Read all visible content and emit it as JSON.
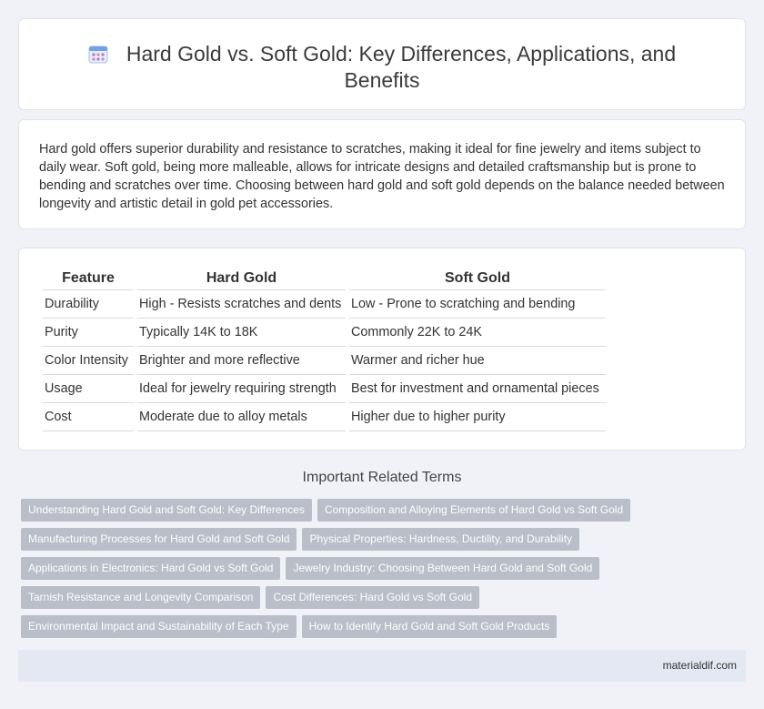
{
  "header": {
    "title": "Hard Gold vs. Soft Gold: Key Differences, Applications, and Benefits",
    "icon": "calendar-grid-icon"
  },
  "intro": {
    "text": "Hard gold offers superior durability and resistance to scratches, making it ideal for fine jewelry and items subject to daily wear. Soft gold, being more malleable, allows for intricate designs and detailed craftsmanship but is prone to bending and scratches over time. Choosing between hard gold and soft gold depends on the balance needed between longevity and artistic detail in gold pet accessories."
  },
  "comparison": {
    "headers": [
      "Feature",
      "Hard Gold",
      "Soft Gold"
    ],
    "rows": [
      [
        "Durability",
        "High - Resists scratches and dents",
        "Low - Prone to scratching and bending"
      ],
      [
        "Purity",
        "Typically 14K to 18K",
        "Commonly 22K to 24K"
      ],
      [
        "Color Intensity",
        "Brighter and more reflective",
        "Warmer and richer hue"
      ],
      [
        "Usage",
        "Ideal for jewelry requiring strength",
        "Best for investment and ornamental pieces"
      ],
      [
        "Cost",
        "Moderate due to alloy metals",
        "Higher due to higher purity"
      ]
    ]
  },
  "related": {
    "title": "Important Related Terms",
    "tags": [
      [
        "Understanding Hard Gold and Soft Gold: Key Differences",
        "Composition and Alloying Elements of Hard Gold vs Soft Gold"
      ],
      [
        "Manufacturing Processes for Hard Gold and Soft Gold",
        "Physical Properties: Hardness, Ductility, and Durability"
      ],
      [
        "Applications in Electronics: Hard Gold vs Soft Gold",
        "Jewelry Industry: Choosing Between Hard Gold and Soft Gold"
      ],
      [
        "Tarnish Resistance and Longevity Comparison",
        "Cost Differences: Hard Gold vs Soft Gold"
      ],
      [
        "Environmental Impact and Sustainability of Each Type",
        "How to Identify Hard Gold and Soft Gold Products"
      ]
    ]
  },
  "footer": {
    "site": "materialdif.com"
  },
  "colors": {
    "background": "#f0f2f7",
    "tag": "#b9bec8",
    "footer": "#e4e8f2",
    "icon_accent": "#6fa2e8"
  }
}
